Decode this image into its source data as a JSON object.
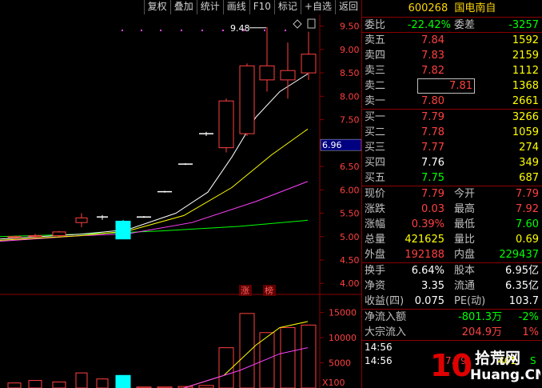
{
  "toolbar": [
    "复权",
    "叠加",
    "统计",
    "画线",
    "F10",
    "标记",
    "+自选",
    "返回"
  ],
  "stock": {
    "code": "600268",
    "name": "国电南自"
  },
  "weibi": {
    "label": "委比",
    "value": "-22.42%",
    "label2": "委差",
    "value2": "-3257"
  },
  "asks": [
    {
      "label": "卖五",
      "price": "7.84",
      "vol": "1592"
    },
    {
      "label": "卖四",
      "price": "7.83",
      "vol": "2159"
    },
    {
      "label": "卖三",
      "price": "7.82",
      "vol": "1112"
    },
    {
      "label": "卖二",
      "price": "7.81",
      "vol": "1368"
    },
    {
      "label": "卖一",
      "price": "7.80",
      "vol": "2661"
    }
  ],
  "bids": [
    {
      "label": "买一",
      "price": "7.79",
      "vol": "3266"
    },
    {
      "label": "买二",
      "price": "7.78",
      "vol": "1059"
    },
    {
      "label": "买三",
      "price": "7.77",
      "vol": "274"
    },
    {
      "label": "买四",
      "price": "7.76",
      "vol": "349"
    },
    {
      "label": "买五",
      "price": "7.75",
      "vol": "687"
    }
  ],
  "stats": [
    {
      "l": "现价",
      "v": "7.79",
      "l2": "今开",
      "v2": "7.79"
    },
    {
      "l": "涨跌",
      "v": "0.03",
      "l2": "最高",
      "v2": "7.92"
    },
    {
      "l": "涨幅",
      "v": "0.39%",
      "l2": "最低",
      "v2": "7.60"
    },
    {
      "l": "总量",
      "v": "421625",
      "l2": "量比",
      "v2": "0.69"
    },
    {
      "l": "外盘",
      "v": "192188",
      "l2": "内盘",
      "v2": "229437"
    }
  ],
  "fund": [
    {
      "l": "换手",
      "v": "6.64%",
      "l2": "股本",
      "v2": "6.95亿"
    },
    {
      "l": "净资",
      "v": "3.35",
      "l2": "流通",
      "v2": "6.35亿"
    },
    {
      "l": "收益(四)",
      "v": "0.075",
      "l2": "PE(动)",
      "v2": "103.7"
    }
  ],
  "flow": [
    {
      "l": "净流入额",
      "v": "-801.3万",
      "v2": "-2%"
    },
    {
      "l": "大宗流入",
      "v": "204.9万",
      "v2": "1%"
    }
  ],
  "ticks": [
    {
      "t": "14:56",
      "p": "",
      "v": ""
    },
    {
      "t": "14:56",
      "p": "7.79",
      "v": "461",
      "f": "S"
    }
  ],
  "price_axis": [
    "9.50",
    "9.00",
    "8.50",
    "8.00",
    "7.50",
    "7.00",
    "6.50",
    "6.00",
    "5.50",
    "5.00",
    "4.50",
    "4.00"
  ],
  "vol_axis": [
    "15000",
    "10000",
    "5000"
  ],
  "vol_unit": "X100",
  "current_price_tag": "6.96",
  "high_label": "9.48",
  "zhangbang": [
    "涨",
    "榜"
  ],
  "watermark": {
    "num": "10",
    "cn": "拾荒网",
    "en": "Huang.CN"
  },
  "colors": {
    "up": "#ff4040",
    "down": "#00ffff",
    "ma5": "#ffffff",
    "ma10": "#ffff00",
    "ma20": "#ff40ff",
    "ma60": "#00ff00"
  },
  "chart_data": {
    "type": "candlestick",
    "price_range": [
      3.85,
      9.75
    ],
    "vol_range": [
      0,
      17000
    ],
    "candles": [
      {
        "o": 4.98,
        "h": 5.02,
        "l": 4.94,
        "c": 5.0,
        "vol": 1000
      },
      {
        "o": 5.0,
        "h": 5.06,
        "l": 4.97,
        "c": 5.02,
        "vol": 1500
      },
      {
        "o": 5.02,
        "h": 5.12,
        "l": 5.0,
        "c": 5.1,
        "vol": 1200
      },
      {
        "o": 5.3,
        "h": 5.5,
        "l": 5.2,
        "c": 5.4,
        "vol": 3000
      },
      {
        "o": 5.42,
        "h": 5.46,
        "l": 5.36,
        "c": 5.42,
        "vol": 1800
      },
      {
        "o": 5.33,
        "h": 5.36,
        "l": 4.95,
        "c": 4.95,
        "vol": 2500
      },
      {
        "o": 5.42,
        "h": 5.44,
        "l": 5.4,
        "c": 5.42,
        "vol": 200
      },
      {
        "o": 5.96,
        "h": 5.98,
        "l": 5.94,
        "c": 5.96,
        "vol": 200
      },
      {
        "o": 6.55,
        "h": 6.57,
        "l": 6.53,
        "c": 6.55,
        "vol": 300
      },
      {
        "o": 7.2,
        "h": 7.24,
        "l": 7.15,
        "c": 7.2,
        "vol": 500
      },
      {
        "o": 6.9,
        "h": 7.95,
        "l": 6.8,
        "c": 7.9,
        "vol": 8000
      },
      {
        "o": 7.2,
        "h": 8.7,
        "l": 7.15,
        "c": 8.65,
        "vol": 14800
      },
      {
        "o": 8.35,
        "h": 9.48,
        "l": 8.1,
        "c": 8.65,
        "vol": 11000
      },
      {
        "o": 8.35,
        "h": 9.15,
        "l": 7.95,
        "c": 8.55,
        "vol": 12000
      },
      {
        "o": 8.5,
        "h": 9.38,
        "l": 8.35,
        "c": 8.9,
        "vol": 12500
      }
    ]
  }
}
